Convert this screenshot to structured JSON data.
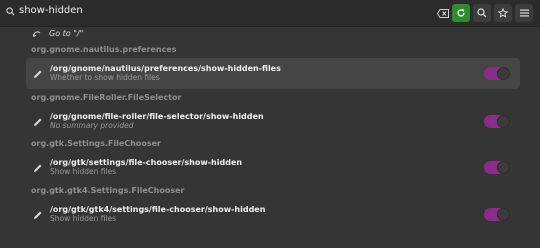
{
  "search": {
    "value": "show-hidden"
  },
  "header": {
    "clear_icon": "backspace-icon",
    "reload_icon": "reload-icon",
    "find_icon": "search-icon",
    "bookmark_icon": "star-icon",
    "menu_icon": "hamburger-menu-icon",
    "accent": "#2e8b30"
  },
  "goto": {
    "label": "Go to \"/\""
  },
  "sections": [
    {
      "title": "org.gnome.nautilus.preferences",
      "key_path": "/org/gnome/nautilus/preferences/show-hidden-files",
      "summary": "Whether to show hidden files",
      "summary_italic": false,
      "enabled": true,
      "selected": true
    },
    {
      "title": "org.gnome.FileRoller.FileSelector",
      "key_path": "/org/gnome/file-roller/file-selector/show-hidden",
      "summary": "No summary provided",
      "summary_italic": true,
      "enabled": true,
      "selected": false
    },
    {
      "title": "org.gtk.Settings.FileChooser",
      "key_path": "/org/gtk/settings/file-chooser/show-hidden",
      "summary": "Show hidden files",
      "summary_italic": false,
      "enabled": true,
      "selected": false
    },
    {
      "title": "org.gtk.gtk4.Settings.FileChooser",
      "key_path": "/org/gtk/gtk4/settings/file-chooser/show-hidden",
      "summary": "Show hidden files",
      "summary_italic": false,
      "enabled": true,
      "selected": false
    }
  ],
  "colors": {
    "toggle_on": "#8a2c8a",
    "background": "#353535",
    "selected_row": "#454545"
  }
}
